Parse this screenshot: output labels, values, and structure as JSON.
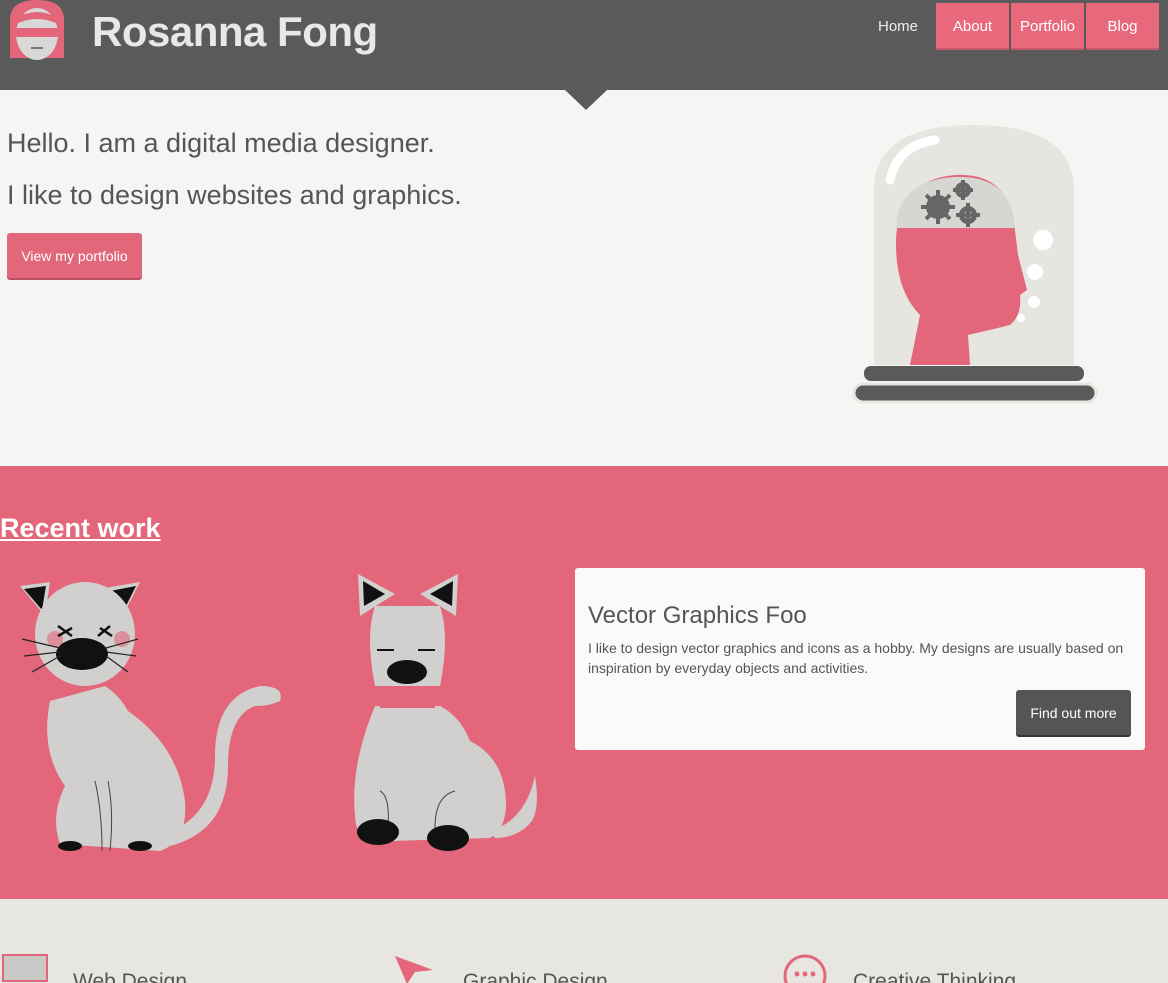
{
  "header": {
    "title": "Rosanna Fong",
    "nav": [
      {
        "label": "Home"
      },
      {
        "label": "About"
      },
      {
        "label": "Portfolio"
      },
      {
        "label": "Blog"
      }
    ]
  },
  "hero": {
    "line1": "Hello. I am a digital media designer.",
    "line2": "I like to design websites and graphics.",
    "button": "View my portfolio"
  },
  "recent": {
    "title": "Recent work",
    "card": {
      "title": "Vector Graphics Foo",
      "text": "I like to design vector graphics and icons as a hobby. My designs are usually based on inspiration by everyday objects and activities.",
      "button": "Find out more"
    }
  },
  "services": [
    {
      "label": "Web Design",
      "icon": "monitor-icon"
    },
    {
      "label": "Graphic Design",
      "icon": "cursor-arrow-icon"
    },
    {
      "label": "Creative Thinking",
      "icon": "speech-bubble-icon"
    }
  ],
  "colors": {
    "accent": "#e3667a",
    "header": "#5a5a5a",
    "background": "#f5f5f3",
    "services_bg": "#e7e6e0"
  }
}
